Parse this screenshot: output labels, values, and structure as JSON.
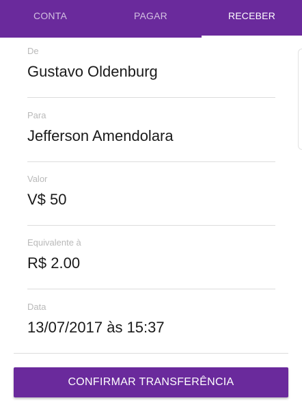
{
  "tabs": [
    {
      "label": "CONTA",
      "active": false
    },
    {
      "label": "PAGAR",
      "active": false
    },
    {
      "label": "RECEBER",
      "active": true
    }
  ],
  "transfer": {
    "from_label": "De",
    "from_value": "Gustavo Oldenburg",
    "to_label": "Para",
    "to_value": "Jefferson Amendolara",
    "amount_label": "Valor",
    "amount_value": "V$ 50",
    "equivalent_label": "Equivalente à",
    "equivalent_value": "R$ 2.00",
    "date_label": "Data",
    "date_value": "13/07/2017 às 15:37"
  },
  "confirm_label": "CONFIRMAR TRANSFERÊNCIA",
  "colors": {
    "brand": "#6a2a9c",
    "text": "#1a1a1a",
    "label": "#b9b9b9",
    "divider": "#dcdcdc"
  }
}
